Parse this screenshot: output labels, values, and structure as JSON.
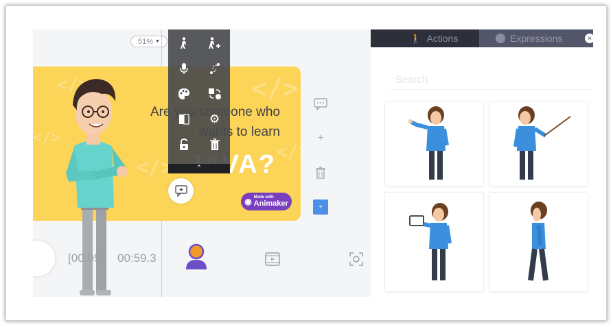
{
  "canvas": {
    "zoom": "51%",
    "slide": {
      "line1": "Are you someone who",
      "line2": "wants to learn",
      "big_word": "JAVA?",
      "badge_small": "Made with",
      "badge_brand": "Animaker"
    }
  },
  "timeline": {
    "current_time": "[00:05]",
    "total_time": "00:59.3"
  },
  "popup_toolbar": {
    "items": [
      "walk-action-icon",
      "add-walk-action-icon",
      "microphone-icon",
      "path-icon",
      "palette-icon",
      "swap-icon",
      "flip-icon",
      "settings-icon",
      "unlock-icon",
      "trash-icon"
    ]
  },
  "right_panel": {
    "tabs": [
      {
        "label": "Actions",
        "icon": "walking-figure-icon",
        "active": true
      },
      {
        "label": "Expressions",
        "icon": "smiley-icon",
        "active": false
      }
    ],
    "search_placeholder": "Search",
    "poses": [
      "pointing-pose",
      "pointer-stick-pose",
      "holding-tablet-pose",
      "side-walk-pose"
    ]
  },
  "colors": {
    "slide_yellow": "#fcd457",
    "character_shirt": "#66d4cc",
    "pose_shirt": "#3b8fdc",
    "accent_blue": "#4d8fe6",
    "badge_purple": "#7a3fbf",
    "avatar_orange": "#f39a2b",
    "avatar_purple": "#6a4fc7"
  }
}
